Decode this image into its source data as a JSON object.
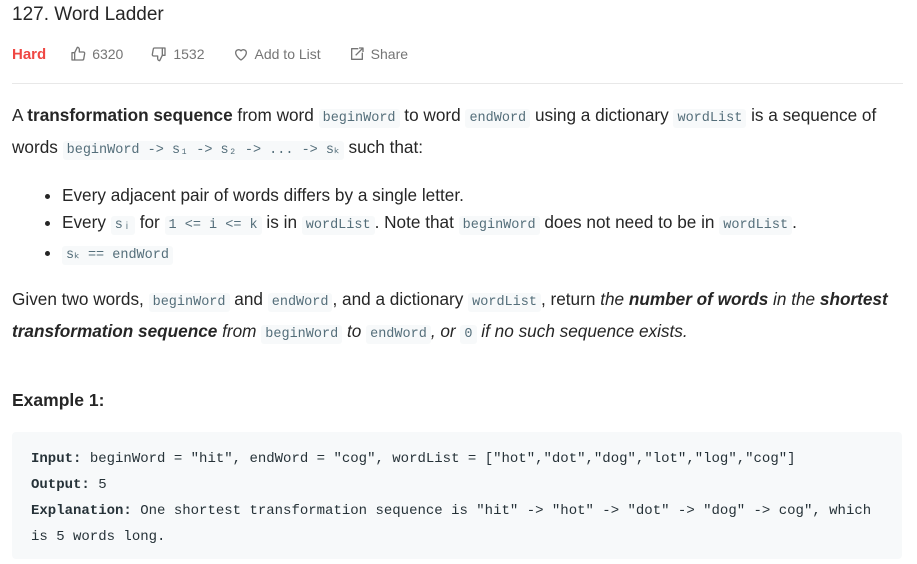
{
  "problem": {
    "title": "127. Word Ladder",
    "difficulty": "Hard",
    "likes": "6320",
    "dislikes": "1532",
    "add_to_list": "Add to List",
    "share": "Share"
  },
  "description": {
    "p1": {
      "a": "A ",
      "b_transformation_sequence": "transformation sequence",
      "c": " from word ",
      "code_beginWord": "beginWord",
      "d": " to word ",
      "code_endWord": "endWord",
      "e": " using a dictionary ",
      "code_wordList": "wordList",
      "f": " is a sequence of words ",
      "code_sequence": "beginWord -> s₁ -> s₂ -> ... -> sₖ",
      "g": " such that:"
    },
    "bullets": {
      "b1": "Every adjacent pair of words differs by a single letter.",
      "b2_a": "Every ",
      "b2_code_si": "sᵢ",
      "b2_b": " for ",
      "b2_code_range": "1 <= i <= k",
      "b2_c": " is in ",
      "b2_code_wordList": "wordList",
      "b2_d": ". Note that ",
      "b2_code_beginWord": "beginWord",
      "b2_e": " does not need to be in ",
      "b2_code_wordList2": "wordList",
      "b2_f": ".",
      "b3_code": "sₖ == endWord"
    },
    "p2": {
      "a": "Given two words, ",
      "code_beginWord": "beginWord",
      "b": " and ",
      "code_endWord": "endWord",
      "c": ", and a dictionary ",
      "code_wordList": "wordList",
      "d": ", return ",
      "e_italic": "the ",
      "f_bold_italic": "number of words",
      "g_italic": " in the ",
      "h_bold_italic": "shortest transformation sequence",
      "i_italic": " from ",
      "code_beginWord2": "beginWord",
      "j_italic": " to ",
      "code_endWord2": "endWord",
      "k_italic": ", or ",
      "code_zero": "0",
      "l_italic": " if no such sequence exists."
    }
  },
  "example1": {
    "title": "Example 1:",
    "input_label": "Input:",
    "input_value": " beginWord = \"hit\", endWord = \"cog\", wordList = [\"hot\",\"dot\",\"dog\",\"lot\",\"log\",\"cog\"]",
    "output_label": "Output:",
    "output_value": " 5",
    "explanation_label": "Explanation:",
    "explanation_value": " One shortest transformation sequence is \"hit\" -> \"hot\" -> \"dot\" -> \"dog\" -> cog\", which is 5 words long."
  },
  "colors": {
    "hard": "#ef4743",
    "meta_text": "#757575",
    "code_bg": "#f7f9fa"
  },
  "icons": [
    "thumbs-up-icon",
    "thumbs-down-icon",
    "heart-icon",
    "share-icon"
  ]
}
